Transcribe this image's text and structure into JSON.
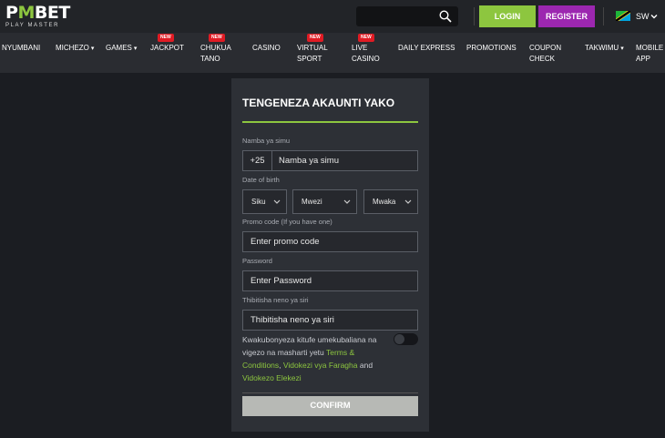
{
  "header": {
    "logo": {
      "main_left": "P",
      "main_mark": "M",
      "main_right": "BET",
      "subtitle": "PLAY MASTER"
    },
    "search": {
      "placeholder": ""
    },
    "login_label": "LOGIN",
    "register_label": "REGISTER",
    "language": {
      "code": "SW",
      "flag_icon": "tanzania-flag-icon"
    }
  },
  "nav": {
    "items": [
      {
        "label": "NYUMBANI"
      },
      {
        "label": "MICHEZO",
        "chevron": "▾"
      },
      {
        "label": "GAMES",
        "chevron": "▾"
      },
      {
        "label": "JACKPOT",
        "badge": "NEW"
      },
      {
        "label_line1": "CHUKUA",
        "label_line2": "TANO",
        "badge": "NEW"
      },
      {
        "label": "CASINO"
      },
      {
        "label_line1": "VIRTUAL",
        "label_line2": "SPORT",
        "badge": "NEW"
      },
      {
        "label_line1": "LIVE",
        "label_line2": "CASINO",
        "badge": "NEW"
      },
      {
        "label": "DAILY EXPRESS"
      },
      {
        "label": "PROMOTIONS"
      },
      {
        "label_line1": "COUPON",
        "label_line2": "CHECK"
      },
      {
        "label": "TAKWIMU",
        "chevron": "▾"
      },
      {
        "label_line1": "MOBILE",
        "label_line2": "APP"
      }
    ]
  },
  "form": {
    "title": "TENGENEZA AKAUNTI YAKO",
    "phone": {
      "label": "Namba ya simu",
      "prefix": "+25",
      "placeholder": "Namba ya simu"
    },
    "dob": {
      "label": "Date of birth",
      "day": "Siku",
      "month": "Mwezi",
      "year": "Mwaka"
    },
    "promo": {
      "label": "Promo code (If you have one)",
      "placeholder": "Enter promo code"
    },
    "password": {
      "label": "Password",
      "placeholder": "Enter Password"
    },
    "confirm_password": {
      "label": "Thibitisha neno ya siri",
      "placeholder": "Thibitisha neno ya siri"
    },
    "terms": {
      "text_before": "Kwakubonyeza kitufe umekubaliana na vigezo na masharti yetu ",
      "link_terms": "Terms & Conditions",
      "sep": ", ",
      "link_faq": "Vidokezi vya Faragha",
      "and": " and ",
      "link_tips": "Vidokezo Elekezi"
    },
    "confirm_label": "CONFIRM"
  },
  "colors": {
    "accent": "#8dc63f",
    "register": "#9c27b0",
    "badge": "#e01b24"
  }
}
